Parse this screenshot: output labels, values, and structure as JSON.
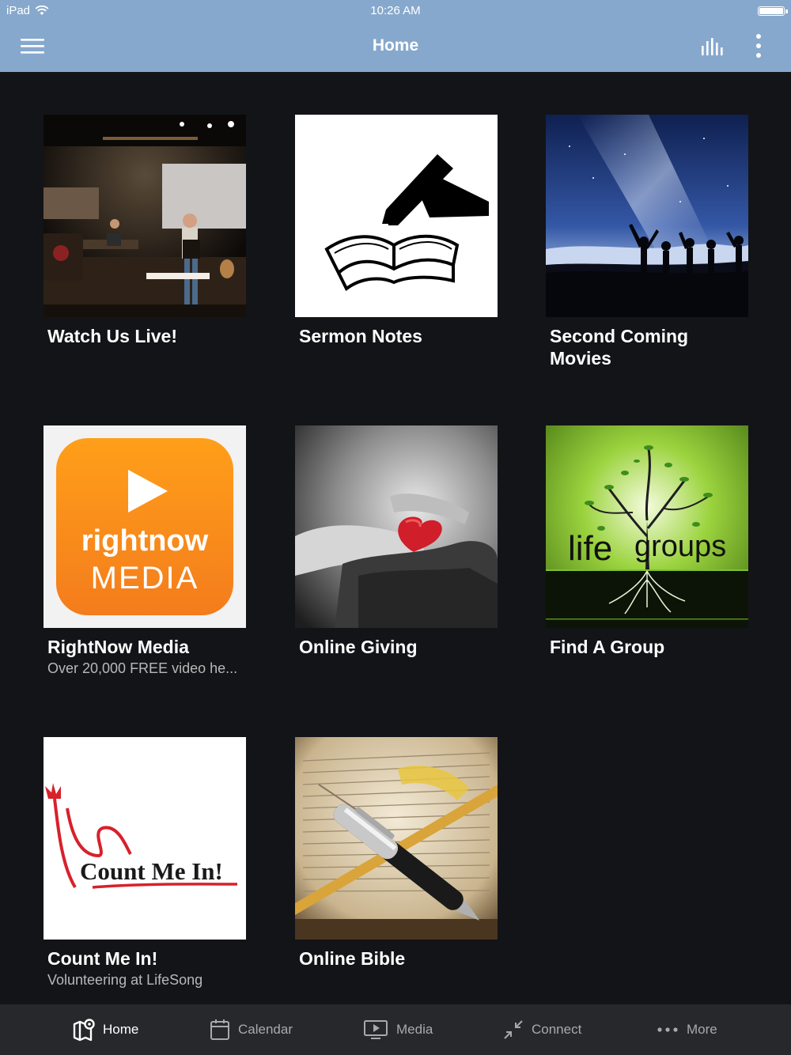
{
  "status_bar": {
    "carrier": "iPad",
    "time": "10:26 AM"
  },
  "header": {
    "title": "Home",
    "menu_icon": "hamburger-menu-icon",
    "audio_icon": "audio-bars-icon",
    "more_icon": "vertical-ellipsis-icon"
  },
  "tiles": [
    {
      "title": "Watch Us Live!",
      "subtitle": "",
      "image": "stage-photo"
    },
    {
      "title": "Sermon Notes",
      "subtitle": "",
      "image": "book-and-pen"
    },
    {
      "title": "Second Coming Movies",
      "subtitle": "",
      "image": "night-sky-people"
    },
    {
      "title": "RightNow Media",
      "subtitle": "Over 20,000 FREE video he...",
      "image": "rightnow-media-logo",
      "logo_word1": "rightnow",
      "logo_word2": "MEDIA"
    },
    {
      "title": "Online Giving",
      "subtitle": "",
      "image": "hands-heart"
    },
    {
      "title": "Find A Group",
      "subtitle": "",
      "image": "life-groups-tree",
      "logo_word1": "life",
      "logo_word2": "groups"
    },
    {
      "title": "Count Me In!",
      "subtitle": "Volunteering at LifeSong",
      "image": "count-me-in-logo",
      "logo_text": "Count Me In!"
    },
    {
      "title": "Online Bible",
      "subtitle": "",
      "image": "bible-and-pen"
    }
  ],
  "tab_bar": [
    {
      "label": "Home",
      "icon": "map-pin-icon",
      "active": true
    },
    {
      "label": "Calendar",
      "icon": "calendar-icon",
      "active": false
    },
    {
      "label": "Media",
      "icon": "play-screen-icon",
      "active": false
    },
    {
      "label": "Connect",
      "icon": "collapse-arrows-icon",
      "active": false
    },
    {
      "label": "More",
      "icon": "horizontal-dots-icon",
      "active": false
    }
  ],
  "colors": {
    "header": "#87a8cd",
    "background": "#131417",
    "tab_bar": "#27282b",
    "tab_active": "#ffffff",
    "tab_inactive": "#a9a9ab",
    "rightnow_orange": "#f7931e",
    "lifegroups_green": "#8bc53f",
    "countmein_red": "#d7212b"
  }
}
